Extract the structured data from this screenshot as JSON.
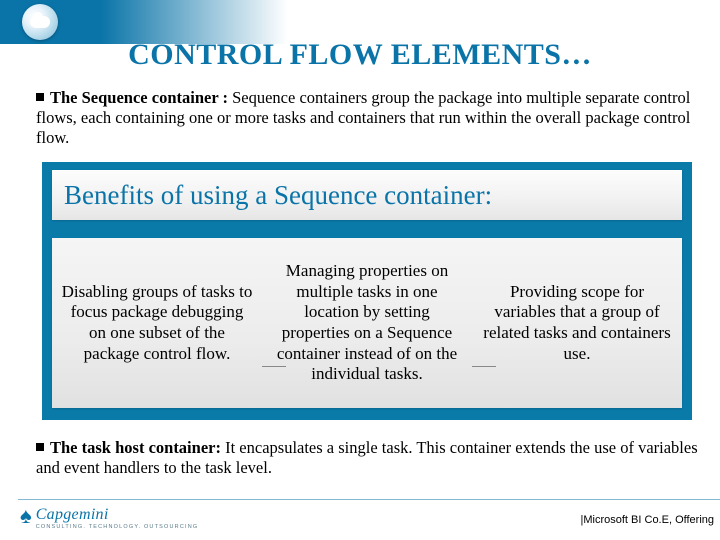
{
  "title": "CONTROL FLOW ELEMENTS…",
  "bullet1": {
    "bold": "The Sequence container :",
    "rest": " Sequence containers group the package into multiple separate control flows, each containing one or more tasks and containers that run within the overall package control flow."
  },
  "benefits_heading": "Benefits of using a Sequence container:",
  "columns": [
    "Disabling groups of tasks to focus package debugging on one subset of the package control flow.",
    "Managing properties on multiple tasks in one location by setting properties on a Sequence container instead of on the individual tasks.",
    "Providing scope for variables that a group of related tasks and containers use."
  ],
  "bullet2": {
    "bold": "The task host container:",
    "rest": " It encapsulates a single task. This container extends the use of variables and event handlers to the task level."
  },
  "footer": {
    "brand": "Capgemini",
    "tagline": "CONSULTING. TECHNOLOGY. OUTSOURCING",
    "right": "|Microsoft BI Co.E, Offering"
  }
}
